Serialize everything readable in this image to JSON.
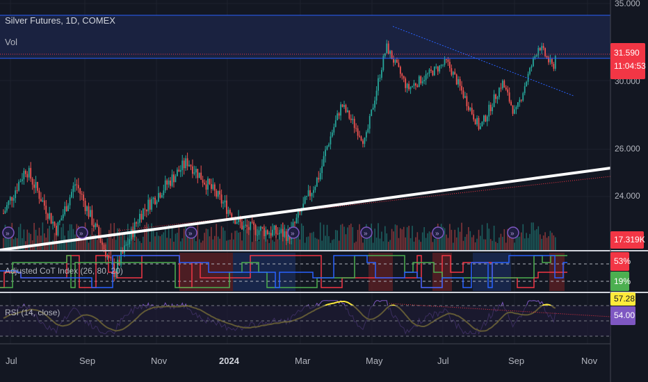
{
  "header": {
    "symbol_title": "Silver Futures, 1D, COMEX",
    "volume_label": "Vol"
  },
  "price_axis": [
    "35.000",
    "30.000",
    "26.000",
    "24.000"
  ],
  "tags": {
    "last_price": "31.590",
    "countdown": "11:04:53",
    "volume": "17.319K",
    "cot_high": "53%",
    "cot_low": "19%",
    "rsi_ma": "57.28",
    "rsi": "54.00"
  },
  "indicators": {
    "cot": "Adjusted CoT Index (26, 80, 20)",
    "rsi": "RSI (14, close)"
  },
  "colors": {
    "up": "#26a69a",
    "down": "#ef5350",
    "bg": "#131722",
    "rsi": "#7e57c2",
    "rsi_ma": "#ffeb3b"
  },
  "chart_data": {
    "type": "candlestick",
    "title": "Silver Futures, 1D, COMEX",
    "x_ticks": [
      "Jul",
      "Sep",
      "Nov",
      "2024",
      "Mar",
      "May",
      "Jul",
      "Sep",
      "Nov"
    ],
    "y_ticks": [
      24,
      26,
      30,
      35
    ],
    "key_closes": [
      {
        "t": "2023-07-01",
        "v": 23.3
      },
      {
        "t": "2023-07-20",
        "v": 25.2
      },
      {
        "t": "2023-08-15",
        "v": 22.6
      },
      {
        "t": "2023-08-31",
        "v": 24.6
      },
      {
        "t": "2023-10-03",
        "v": 20.8
      },
      {
        "t": "2023-10-25",
        "v": 23.3
      },
      {
        "t": "2023-12-04",
        "v": 25.5
      },
      {
        "t": "2024-01-20",
        "v": 22.7
      },
      {
        "t": "2024-02-28",
        "v": 22.4
      },
      {
        "t": "2024-03-25",
        "v": 25.0
      },
      {
        "t": "2024-04-12",
        "v": 28.6
      },
      {
        "t": "2024-05-02",
        "v": 26.4
      },
      {
        "t": "2024-05-20",
        "v": 32.2
      },
      {
        "t": "2024-06-07",
        "v": 29.5
      },
      {
        "t": "2024-07-10",
        "v": 31.2
      },
      {
        "t": "2024-08-07",
        "v": 27.2
      },
      {
        "t": "2024-08-26",
        "v": 29.9
      },
      {
        "t": "2024-09-06",
        "v": 28.0
      },
      {
        "t": "2024-09-26",
        "v": 32.3
      },
      {
        "t": "2024-10-08",
        "v": 30.8
      },
      {
        "t": "2024-10-10",
        "v": 31.59
      }
    ],
    "last_price": 31.59,
    "last_volume": "17.319K",
    "cot_index": {
      "high_band": 80,
      "low_band": 20,
      "last_values": [
        53,
        19
      ]
    },
    "rsi": {
      "period": 14,
      "last": 54.0,
      "ma": 57.28,
      "levels": [
        70,
        50,
        30
      ]
    }
  }
}
